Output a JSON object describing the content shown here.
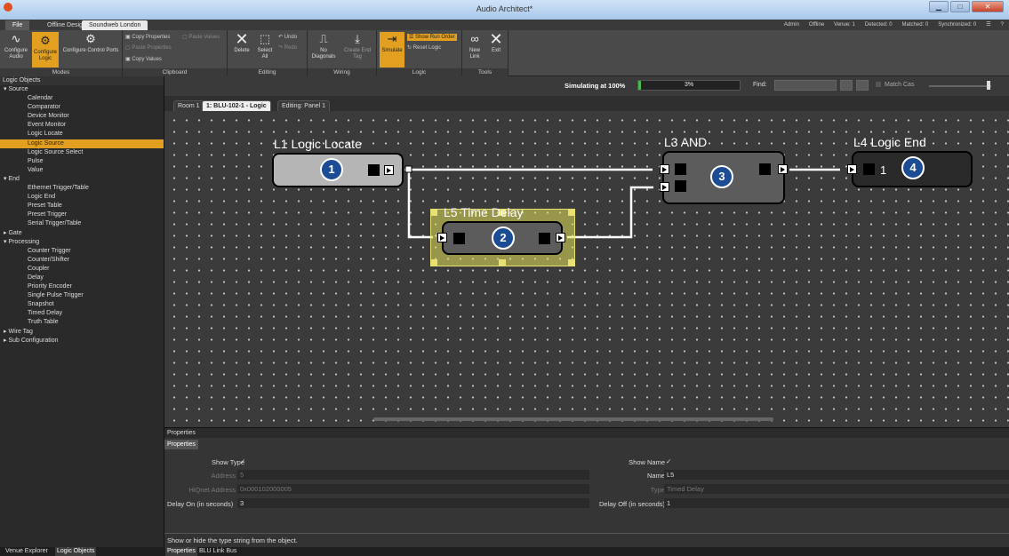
{
  "window": {
    "title": "Audio Architect*"
  },
  "tabs": {
    "file": "File",
    "offline": "Offline Design",
    "soundweb": "Soundweb London"
  },
  "status": [
    "Admin",
    "Offline",
    "Venue: 1",
    "Detected: 0",
    "Matched: 0",
    "Synchronized: 0"
  ],
  "ribbon": {
    "modes": {
      "label": "Modes",
      "configure_audio": "Configure Audio",
      "configure_logic": "Configure Logic",
      "configure_control_ports": "Configure Control Ports"
    },
    "clipboard": {
      "label": "Clipboard",
      "copy_properties": "Copy Properties",
      "paste_values": "Paste Values",
      "paste_properties": "Paste Properties",
      "copy_values": "Copy Values"
    },
    "editing": {
      "label": "Editing",
      "delete": "Delete",
      "select_all": "Select All",
      "undo": "Undo",
      "redo": "Redo"
    },
    "wiring": {
      "label": "Wiring",
      "no_diagonals": "No Diagonals",
      "create_end_tag": "Create End Tag"
    },
    "logic": {
      "label": "Logic",
      "simulate": "Simulate",
      "show_run_order": "Show Run Order",
      "reset_logic": "Reset Logic"
    },
    "tools": {
      "label": "Tools",
      "new_link": "New Link",
      "exit": "Exit"
    }
  },
  "left": {
    "header": "Logic Objects",
    "tree": [
      {
        "t": "cat",
        "label": "▾ Source"
      },
      {
        "t": "leaf",
        "label": "Calendar"
      },
      {
        "t": "leaf",
        "label": "Comparator"
      },
      {
        "t": "leaf",
        "label": "Device Monitor"
      },
      {
        "t": "leaf",
        "label": "Event Monitor"
      },
      {
        "t": "leaf",
        "label": "Logic Locate"
      },
      {
        "t": "leaf",
        "label": "Logic Source",
        "sel": true
      },
      {
        "t": "leaf",
        "label": "Logic Source Select"
      },
      {
        "t": "leaf",
        "label": "Pulse"
      },
      {
        "t": "leaf",
        "label": "Value"
      },
      {
        "t": "cat",
        "label": "▾ End"
      },
      {
        "t": "leaf",
        "label": "Ethernet Trigger/Table"
      },
      {
        "t": "leaf",
        "label": "Logic End"
      },
      {
        "t": "leaf",
        "label": "Preset Table"
      },
      {
        "t": "leaf",
        "label": "Preset Trigger"
      },
      {
        "t": "leaf",
        "label": "Serial Trigger/Table"
      },
      {
        "t": "cat",
        "label": "▸ Gate"
      },
      {
        "t": "cat",
        "label": "▾ Processing"
      },
      {
        "t": "leaf",
        "label": "Counter Trigger"
      },
      {
        "t": "leaf",
        "label": "Counter/Shifter"
      },
      {
        "t": "leaf",
        "label": "Coupler"
      },
      {
        "t": "leaf",
        "label": "Delay"
      },
      {
        "t": "leaf",
        "label": "Priority Encoder"
      },
      {
        "t": "leaf",
        "label": "Single Pulse Trigger"
      },
      {
        "t": "leaf",
        "label": "Snapshot"
      },
      {
        "t": "leaf",
        "label": "Timed Delay"
      },
      {
        "t": "leaf",
        "label": "Truth Table"
      },
      {
        "t": "cat",
        "label": "▸ Wire Tag"
      },
      {
        "t": "cat",
        "label": "▸ Sub Configuration"
      }
    ]
  },
  "bottom_tabs": {
    "venue": "Venue Explorer",
    "logic": "Logic Objects",
    "properties": "Properties",
    "blu": "BLU Link Bus"
  },
  "toolbar2": {
    "sim_label": "Simulating at 100%",
    "sim_pct": "3%",
    "sim_fraction": 0.03,
    "find_label": "Find:",
    "find_value": "",
    "match_case": "Match Cas"
  },
  "doc_tabs": {
    "room": "Room 1",
    "device": "1: BLU-102-1 - Logic",
    "editing": "Editing: Panel 1"
  },
  "blocks": {
    "l1": {
      "name": "L1  Logic Locate",
      "num": "1"
    },
    "l3": {
      "name": "L3  AND",
      "num": "3"
    },
    "l4": {
      "name": "L4  Logic End",
      "num": "4",
      "val": "1"
    },
    "l5": {
      "name": "L5  Time   Delay",
      "num": "2"
    }
  },
  "props": {
    "header": "Properties",
    "tab": "Properties",
    "show_type_label": "Show Type",
    "show_type_val": "✓",
    "address_label": "Address",
    "address_val": "5",
    "hiqnet_label": "HiQnet Address",
    "hiqnet_val": "0x000102000005",
    "delay_on_label": "Delay On (in seconds)",
    "delay_on_val": "3",
    "show_name_label": "Show Name",
    "show_name_val": "✓",
    "name_label": "Name",
    "name_val": "L5",
    "type_label": "Type",
    "type_val": "Timed Delay",
    "delay_off_label": "Delay Off (in seconds)",
    "delay_off_val": "1",
    "hint": "Show or hide the type string from the object."
  },
  "colors": {
    "accent": "#e3a020",
    "node": "#1c4c94",
    "sim_fill": "#3ec04a"
  }
}
